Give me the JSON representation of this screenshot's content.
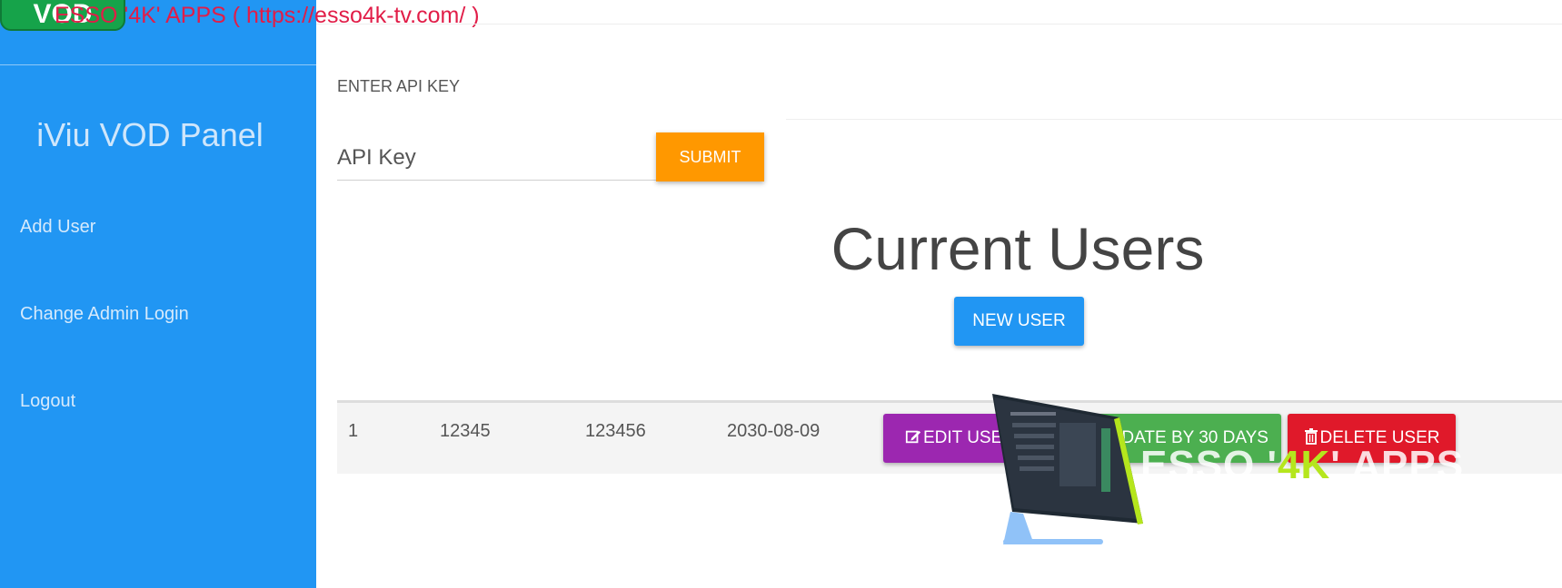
{
  "header": {
    "banner_text": "ESSO '4K' APPS (  https://esso4k-tv.com/ )",
    "logo_button": "VOD"
  },
  "sidebar": {
    "title": "iViu VOD Panel",
    "items": [
      {
        "label": "Add User"
      },
      {
        "label": "Change Admin Login"
      },
      {
        "label": "Logout"
      }
    ]
  },
  "api": {
    "label": "ENTER API KEY",
    "placeholder": "API Key",
    "value": "",
    "submit_label": "SUBMIT"
  },
  "main": {
    "heading": "Current Users",
    "new_user_label": "NEW USER"
  },
  "table": {
    "rows": [
      {
        "id": "1",
        "username": "12345",
        "password": "123456",
        "expiry": "2030-08-09",
        "edit_label": "EDIT USER",
        "update_label": "UPDATE BY 30 DAYS",
        "delete_label": "DELETE USER"
      }
    ]
  },
  "watermark": {
    "text_a": "ESSO '",
    "text_b": "4K",
    "text_c": "' APPS"
  },
  "colors": {
    "sidebar": "#2196f3",
    "submit": "#ff9800",
    "edit": "#9c27b0",
    "update": "#4caf50",
    "delete": "#e0192a",
    "banner": "#e11d48"
  },
  "icons": [
    "edit-icon",
    "trash-icon",
    "monitor-icon"
  ]
}
